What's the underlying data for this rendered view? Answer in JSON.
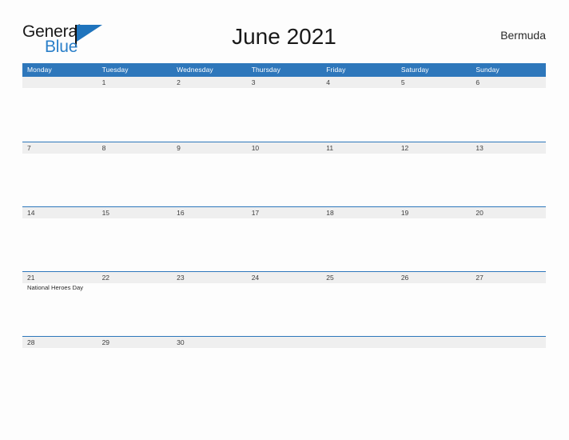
{
  "brand": {
    "name_part1": "General",
    "name_part2": "Blue",
    "triangle_color": "#1f74bd",
    "blue_color": "#2a7fc9"
  },
  "header": {
    "title": "June 2021",
    "country": "Bermuda"
  },
  "theme": {
    "header_blue": "#2e77bb",
    "band_gray": "#efefef",
    "page_background": "#fdfdfd",
    "text_dark": "#3d3d3d"
  },
  "weekdays": [
    "Monday",
    "Tuesday",
    "Wednesday",
    "Thursday",
    "Friday",
    "Saturday",
    "Sunday"
  ],
  "weeks": [
    {
      "days": [
        {
          "num": "",
          "event": ""
        },
        {
          "num": "1",
          "event": ""
        },
        {
          "num": "2",
          "event": ""
        },
        {
          "num": "3",
          "event": ""
        },
        {
          "num": "4",
          "event": ""
        },
        {
          "num": "5",
          "event": ""
        },
        {
          "num": "6",
          "event": ""
        }
      ]
    },
    {
      "days": [
        {
          "num": "7",
          "event": ""
        },
        {
          "num": "8",
          "event": ""
        },
        {
          "num": "9",
          "event": ""
        },
        {
          "num": "10",
          "event": ""
        },
        {
          "num": "11",
          "event": ""
        },
        {
          "num": "12",
          "event": ""
        },
        {
          "num": "13",
          "event": ""
        }
      ]
    },
    {
      "days": [
        {
          "num": "14",
          "event": ""
        },
        {
          "num": "15",
          "event": ""
        },
        {
          "num": "16",
          "event": ""
        },
        {
          "num": "17",
          "event": ""
        },
        {
          "num": "18",
          "event": ""
        },
        {
          "num": "19",
          "event": ""
        },
        {
          "num": "20",
          "event": ""
        }
      ]
    },
    {
      "days": [
        {
          "num": "21",
          "event": "National Heroes Day"
        },
        {
          "num": "22",
          "event": ""
        },
        {
          "num": "23",
          "event": ""
        },
        {
          "num": "24",
          "event": ""
        },
        {
          "num": "25",
          "event": ""
        },
        {
          "num": "26",
          "event": ""
        },
        {
          "num": "27",
          "event": ""
        }
      ]
    },
    {
      "days": [
        {
          "num": "28",
          "event": ""
        },
        {
          "num": "29",
          "event": ""
        },
        {
          "num": "30",
          "event": ""
        },
        {
          "num": "",
          "event": ""
        },
        {
          "num": "",
          "event": ""
        },
        {
          "num": "",
          "event": ""
        },
        {
          "num": "",
          "event": ""
        }
      ]
    }
  ]
}
